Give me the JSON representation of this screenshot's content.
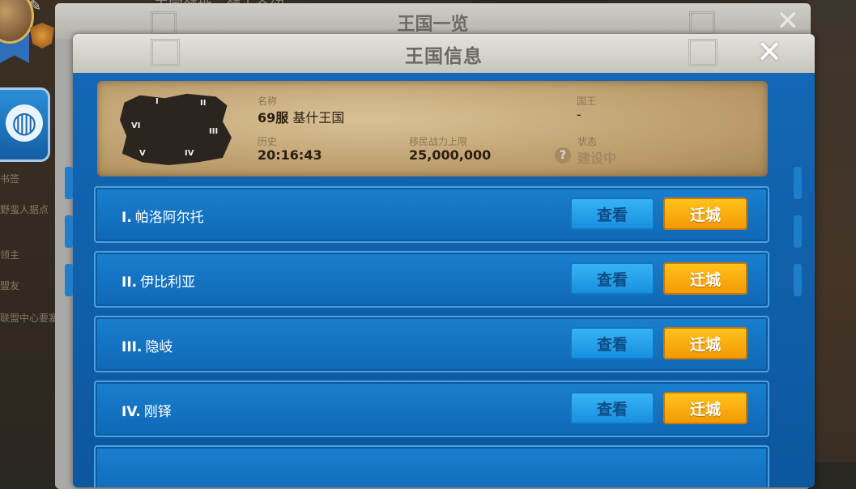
{
  "background": {
    "top_text": "王国领地 · 领土介绍",
    "side_texts": [
      "书签",
      "野蛮人据点",
      "领主",
      "盟友",
      "联盟中心要塞"
    ]
  },
  "back_panel": {
    "title": "王国一览",
    "close_glyph": "✕"
  },
  "panel": {
    "title": "王国信息",
    "close_glyph": "✕"
  },
  "kingdom": {
    "name_label": "名称",
    "server": "69服",
    "name": "基什王国",
    "king_label": "国王",
    "king_value": "-",
    "history_label": "历史",
    "history_value": "20:16:43",
    "migration_label": "移民战力上限",
    "migration_value": "25,000,000",
    "status_label": "状态",
    "status_value": "建设中",
    "help_glyph": "?",
    "map_labels": [
      "I",
      "II",
      "III",
      "IV",
      "V",
      "VI"
    ]
  },
  "regions": [
    {
      "numeral": "I.",
      "name": "帕洛阿尔托",
      "view_label": "查看",
      "move_label": "迁城"
    },
    {
      "numeral": "II.",
      "name": "伊比利亚",
      "view_label": "查看",
      "move_label": "迁城"
    },
    {
      "numeral": "III.",
      "name": "隐岐",
      "view_label": "查看",
      "move_label": "迁城"
    },
    {
      "numeral": "IV.",
      "name": "刚铎",
      "view_label": "查看",
      "move_label": "迁城"
    }
  ],
  "icons": {
    "globe": "globe-icon",
    "edit": "pencil-icon",
    "rank": "shield-icon"
  }
}
